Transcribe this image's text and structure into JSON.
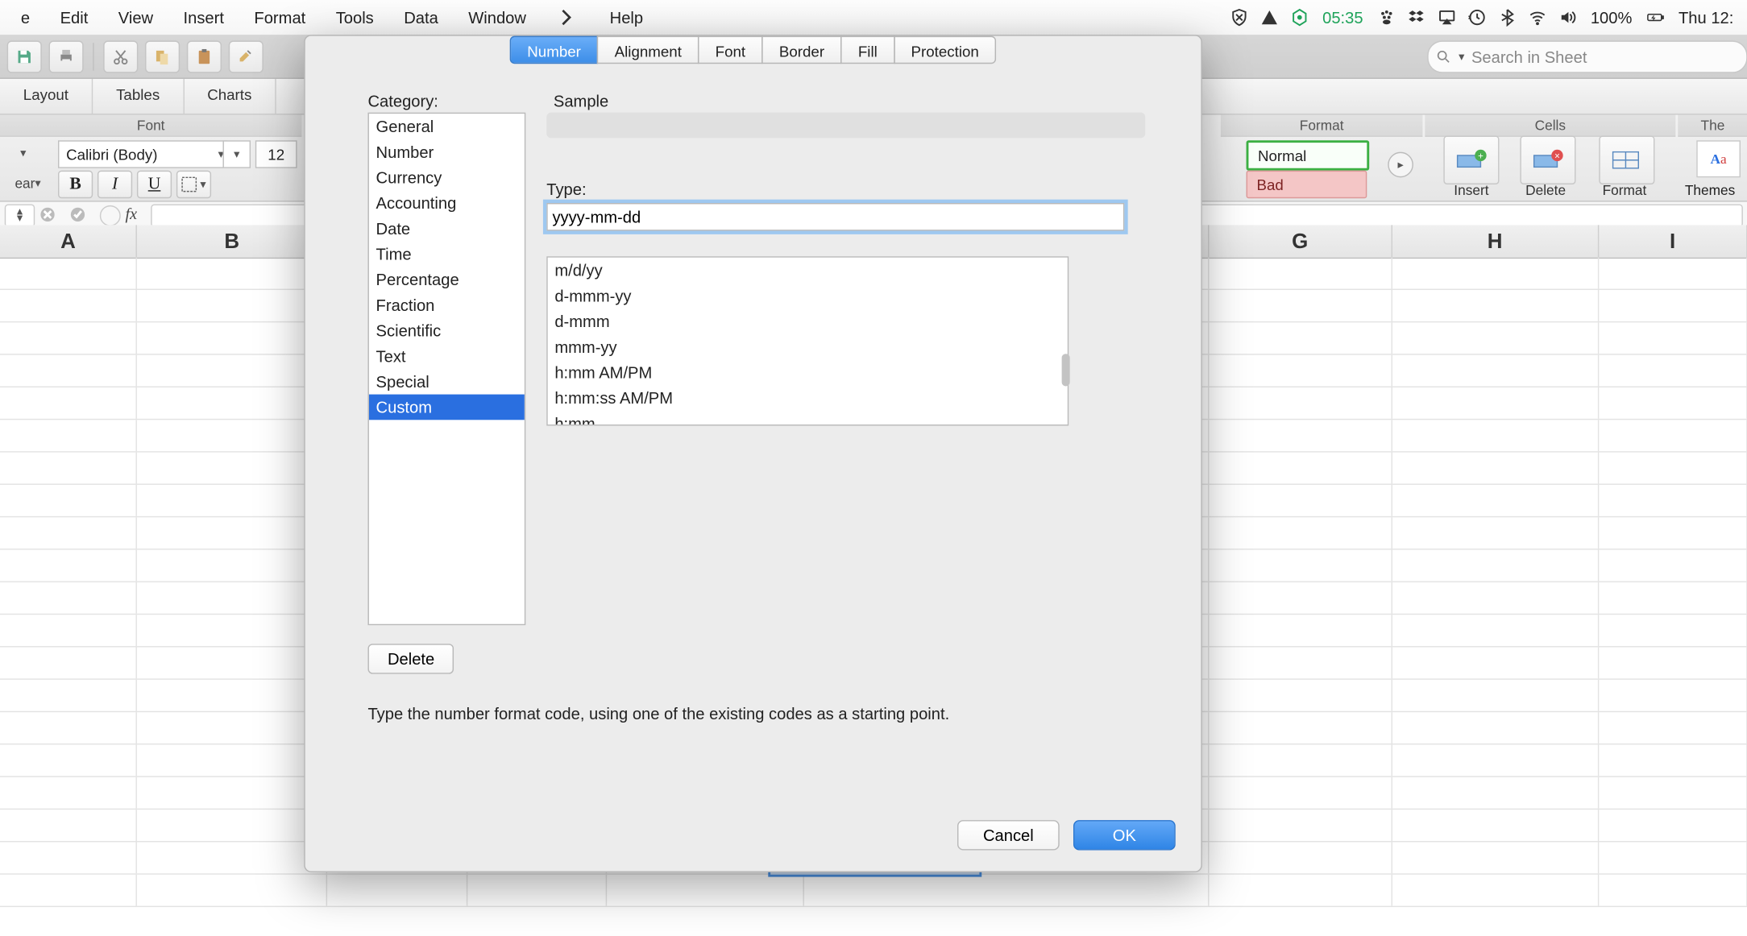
{
  "menu_bar": {
    "items": [
      "e",
      "Edit",
      "View",
      "Insert",
      "Format",
      "Tools",
      "Data",
      "Window",
      "",
      "Help"
    ],
    "status": {
      "time": "05:35",
      "battery": "100%",
      "clock": "Thu 12:"
    }
  },
  "toolstrip": {
    "search_placeholder": "Search in Sheet"
  },
  "ribbon": {
    "tabs": [
      "Layout",
      "Tables",
      "Charts"
    ],
    "groups": {
      "font": "Font",
      "format": "Format",
      "cells": "Cells",
      "themes": "The"
    },
    "font_name": "Calibri (Body)",
    "font_size": "12",
    "clear_label": "ear",
    "biu": {
      "bold": "B",
      "italic": "I",
      "underline": "U"
    },
    "format_chips": {
      "normal": "Normal",
      "bad": "Bad"
    },
    "cells_labels": {
      "insert": "Insert",
      "delete": "Delete",
      "format": "Format"
    },
    "themes_label": "Themes",
    "themes_swatch": "Aa"
  },
  "formula_bar": {
    "fx_label": "fx"
  },
  "grid": {
    "columns": [
      "A",
      "B",
      "",
      "",
      "",
      "",
      "G",
      "H",
      "I"
    ]
  },
  "dialog": {
    "tabs": [
      "Number",
      "Alignment",
      "Font",
      "Border",
      "Fill",
      "Protection"
    ],
    "selected_tab": 0,
    "category_label": "Category:",
    "sample_label": "Sample",
    "type_label": "Type:",
    "type_value": "yyyy-mm-dd",
    "categories": [
      "General",
      "Number",
      "Currency",
      "Accounting",
      "Date",
      "Time",
      "Percentage",
      "Fraction",
      "Scientific",
      "Text",
      "Special",
      "Custom"
    ],
    "selected_category": 11,
    "type_formats": [
      "m/d/yy",
      "d-mmm-yy",
      "d-mmm",
      "mmm-yy",
      "h:mm AM/PM",
      "h:mm:ss AM/PM",
      "h:mm"
    ],
    "delete_label": "Delete",
    "help_text": "Type the number format code, using one of the existing codes as a starting point.",
    "cancel_label": "Cancel",
    "ok_label": "OK"
  }
}
